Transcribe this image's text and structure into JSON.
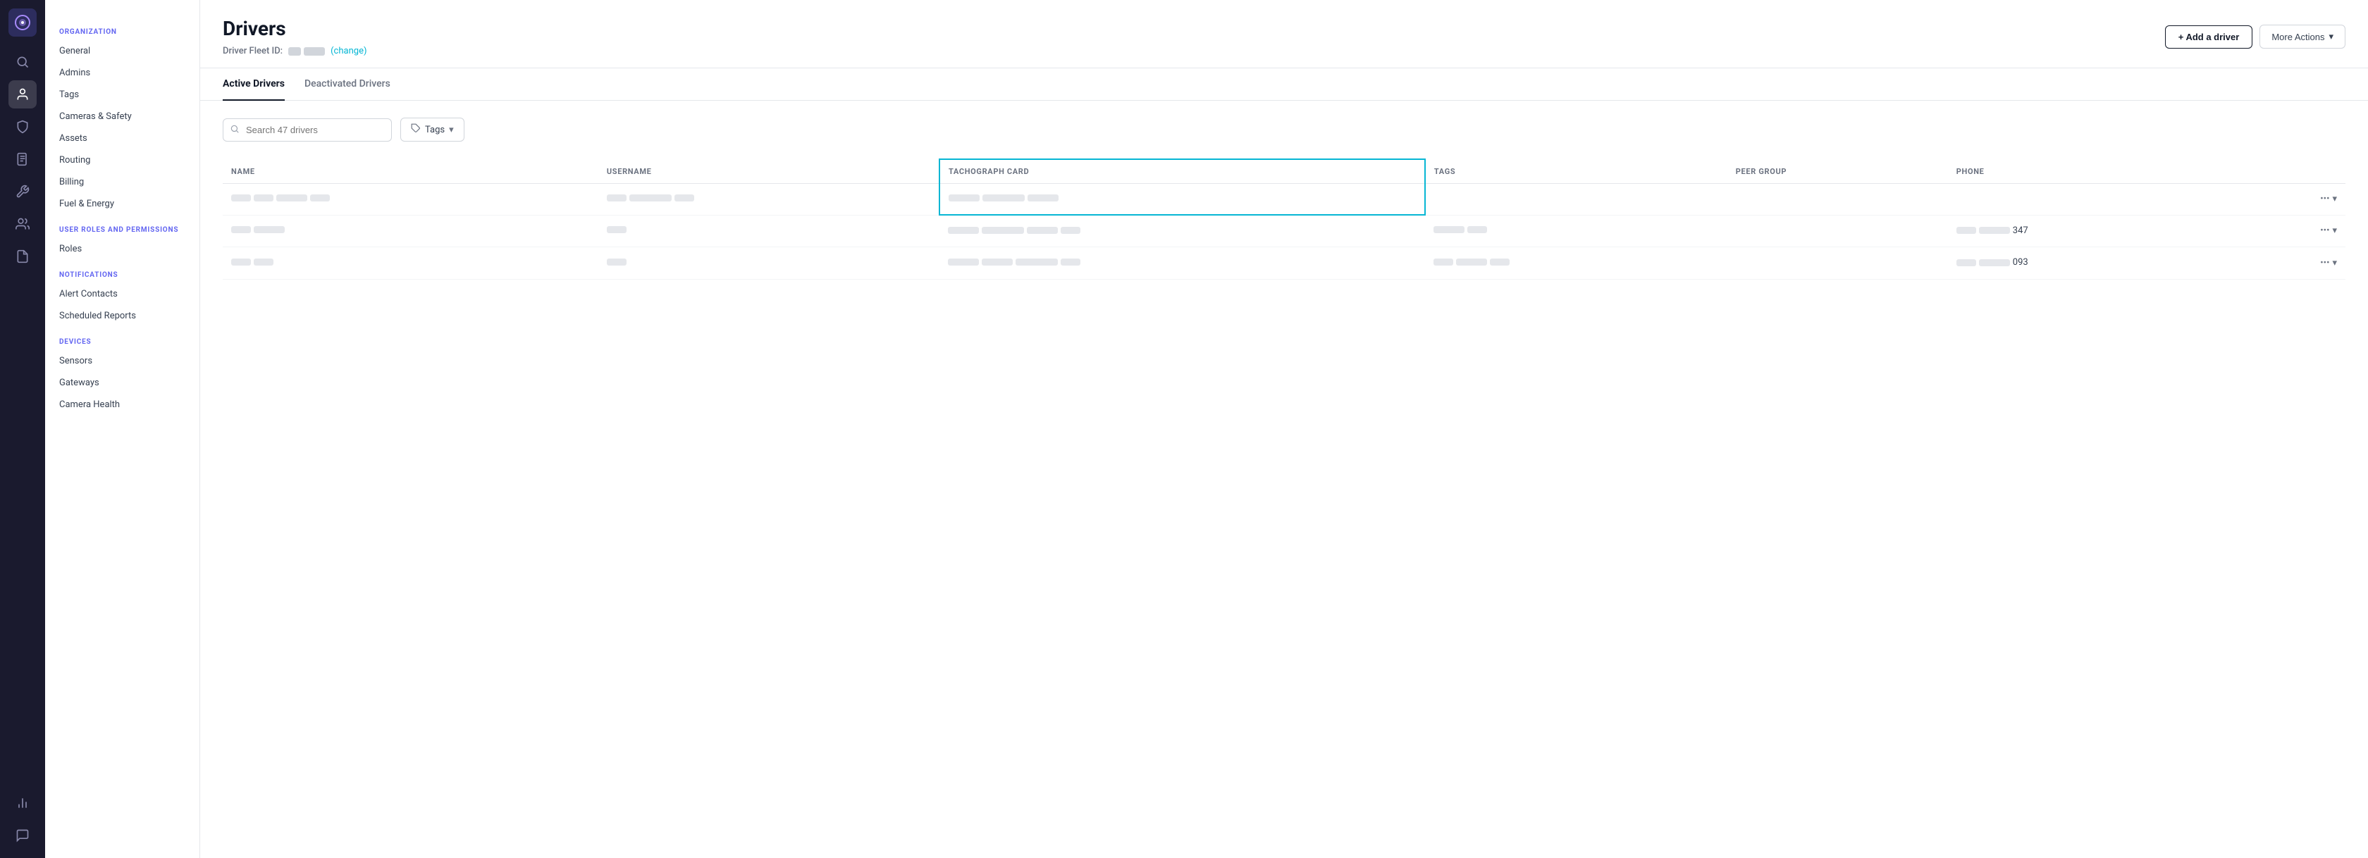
{
  "app": {
    "title": "Drivers"
  },
  "iconBar": {
    "icons": [
      {
        "name": "logo-icon",
        "label": "Logo"
      },
      {
        "name": "search-icon",
        "label": "Search"
      },
      {
        "name": "driver-icon",
        "label": "Drivers"
      },
      {
        "name": "safety-icon",
        "label": "Safety"
      },
      {
        "name": "document-icon",
        "label": "Documents"
      },
      {
        "name": "wrench-icon",
        "label": "Settings"
      },
      {
        "name": "group-icon",
        "label": "Groups"
      },
      {
        "name": "report-icon",
        "label": "Reports"
      },
      {
        "name": "analytics-icon",
        "label": "Analytics"
      },
      {
        "name": "chat-icon",
        "label": "Chat"
      }
    ]
  },
  "sidebar": {
    "sections": [
      {
        "label": "Organization",
        "items": [
          {
            "label": "General",
            "active": false
          },
          {
            "label": "Admins",
            "active": false
          },
          {
            "label": "Tags",
            "active": false
          },
          {
            "label": "Cameras & Safety",
            "active": false
          },
          {
            "label": "Assets",
            "active": false
          },
          {
            "label": "Routing",
            "active": false
          },
          {
            "label": "Billing",
            "active": false
          },
          {
            "label": "Fuel & Energy",
            "active": false
          }
        ]
      },
      {
        "label": "User Roles and Permissions",
        "items": [
          {
            "label": "Roles",
            "active": false
          }
        ]
      },
      {
        "label": "Notifications",
        "items": [
          {
            "label": "Alert Contacts",
            "active": false
          },
          {
            "label": "Scheduled Reports",
            "active": false
          }
        ]
      },
      {
        "label": "Devices",
        "items": [
          {
            "label": "Sensors",
            "active": false
          },
          {
            "label": "Gateways",
            "active": false
          },
          {
            "label": "Camera Health",
            "active": false
          }
        ]
      }
    ]
  },
  "header": {
    "title": "Drivers",
    "fleetIdLabel": "Driver Fleet ID:",
    "changeLink": "(change)",
    "addDriverLabel": "+ Add a driver",
    "moreActionsLabel": "More Actions"
  },
  "tabs": [
    {
      "label": "Active Drivers",
      "active": true
    },
    {
      "label": "Deactivated Drivers",
      "active": false
    }
  ],
  "filters": {
    "searchPlaceholder": "Search 47 drivers",
    "tagsLabel": "Tags"
  },
  "table": {
    "columns": [
      {
        "key": "name",
        "label": "Name"
      },
      {
        "key": "username",
        "label": "Username"
      },
      {
        "key": "tachograph",
        "label": "Tachograph Card"
      },
      {
        "key": "tags",
        "label": "Tags"
      },
      {
        "key": "peerGroup",
        "label": "Peer Group"
      },
      {
        "key": "phone",
        "label": "Phone"
      }
    ],
    "rows": [
      {
        "phone": "",
        "isFirst": true
      },
      {
        "phone": "347",
        "isFirst": false
      },
      {
        "phone": "093",
        "isFirst": false
      }
    ]
  }
}
